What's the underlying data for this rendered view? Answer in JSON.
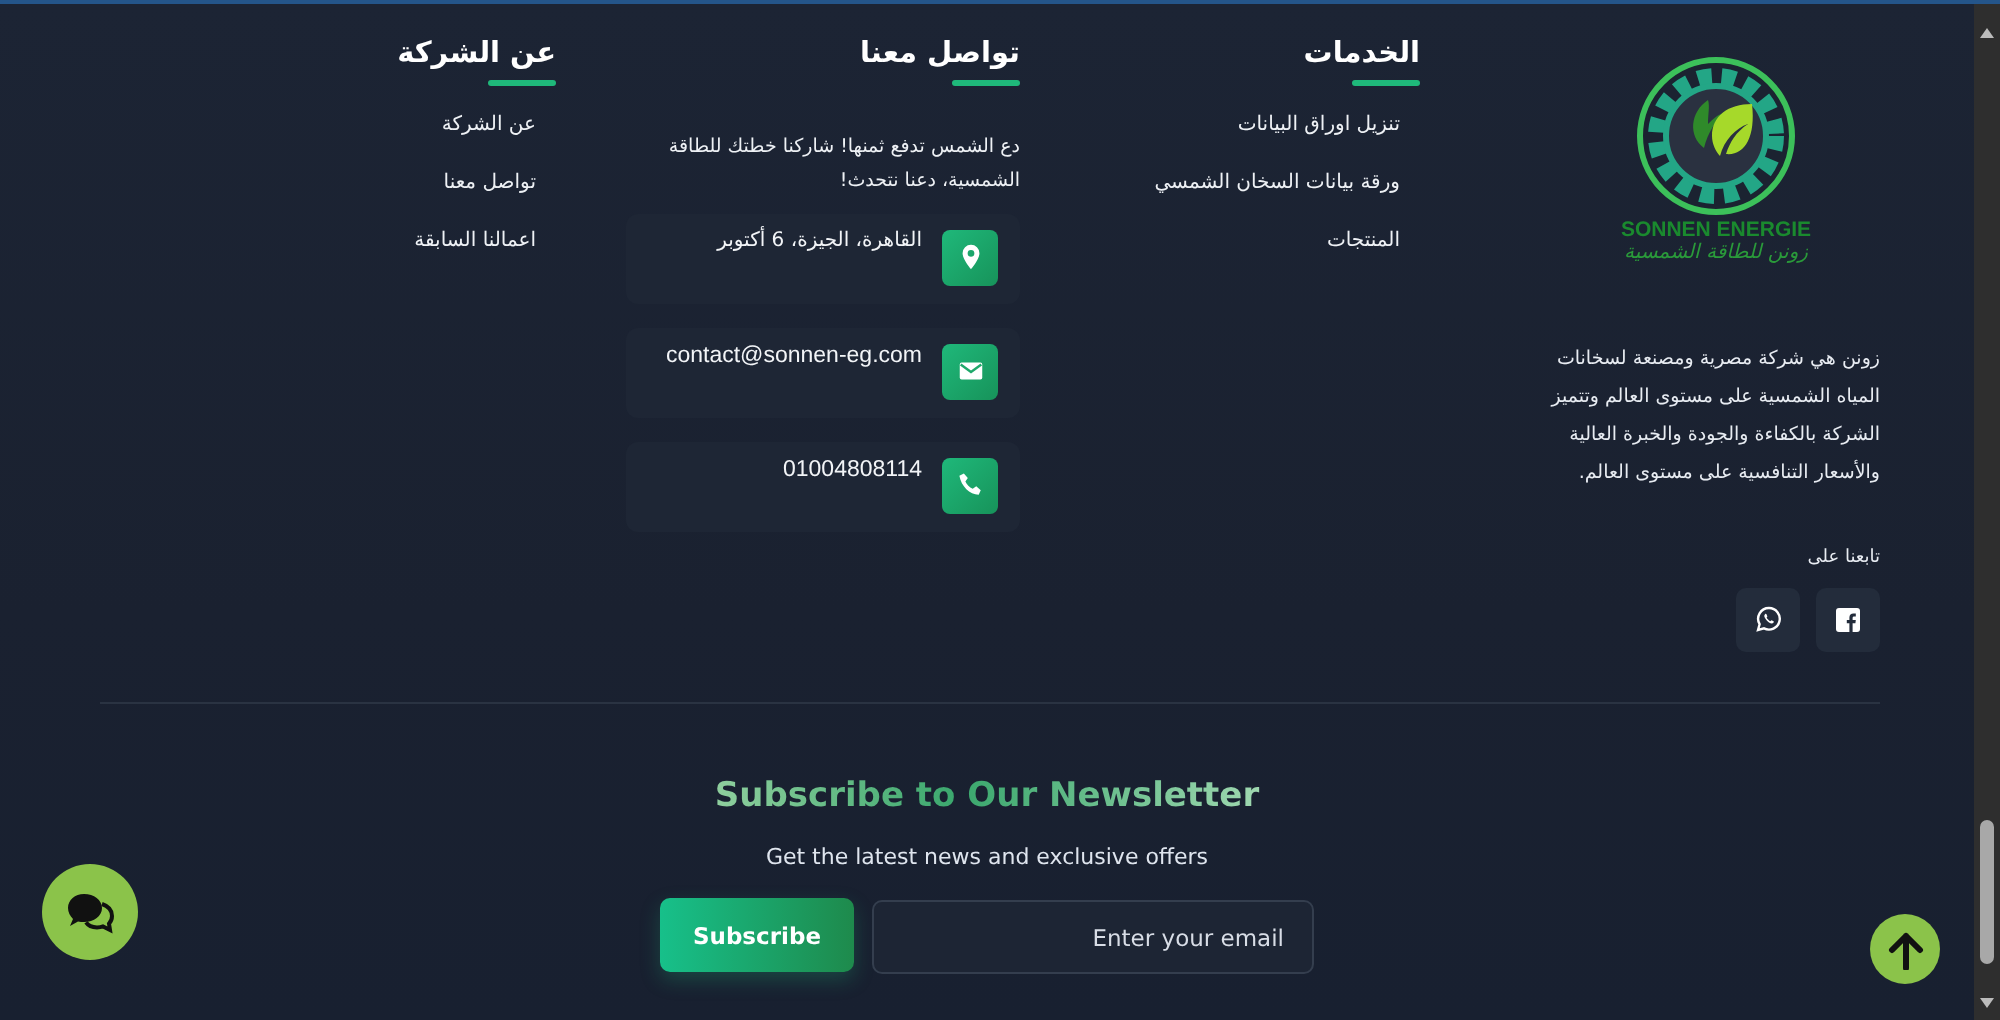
{
  "brand": {
    "name": "SONNEN ENERGIE",
    "tagline": "زونن للطاقة الشمسية"
  },
  "about": "زونن هي شركة مصرية ومصنعة لسخانات المياه الشمسية على مستوى العالم وتتميز الشركة بالكفاءة والجودة والخبرة العالية والأسعار التنافسية على مستوى العالم.",
  "follow_label": "تابعنا على",
  "socials": [
    {
      "kind": "facebook"
    },
    {
      "kind": "whatsapp"
    }
  ],
  "services": {
    "title": "الخدمات",
    "links": [
      "تنزيل اوراق البيانات",
      "ورقة بيانات السخان الشمسي",
      "المنتجات"
    ]
  },
  "contact": {
    "title": "تواصل معنا",
    "intro": "دع الشمس تدفع ثمنها! شاركنا خطتك للطاقة الشمسية، دعنا نتحدث!",
    "items": [
      {
        "kind": "location",
        "text": "القاهرة، الجيزة، 6 أكتوبر"
      },
      {
        "kind": "email",
        "text": "contact@sonnen-eg.com"
      },
      {
        "kind": "phone",
        "text": "01004808114"
      }
    ]
  },
  "company": {
    "title": "عن الشركة",
    "links": [
      "عن الشركة",
      "تواصل معنا",
      "اعمالنا السابقة"
    ]
  },
  "newsletter": {
    "title": "Subscribe to Our Newsletter",
    "subtitle": "Get the latest news and exclusive offers",
    "button": "Subscribe",
    "email_placeholder": "Enter your email"
  }
}
